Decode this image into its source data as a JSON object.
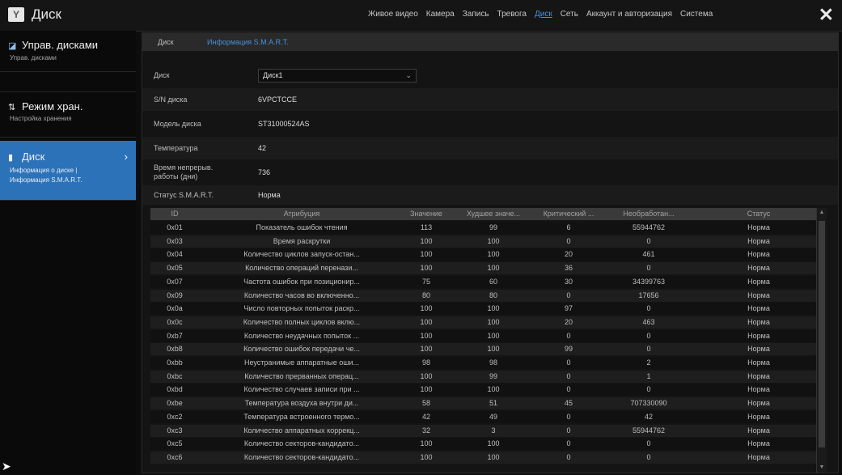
{
  "app": {
    "title": "Диск"
  },
  "nav": {
    "items": [
      "Живое видео",
      "Камера",
      "Запись",
      "Тревога",
      "Диск",
      "Сеть",
      "Аккаунт и авторизация",
      "Система"
    ],
    "active": "Диск"
  },
  "sidebar": {
    "items": [
      {
        "title": "Управ. дисками",
        "subs": [
          "Управ. дисками"
        ]
      },
      {
        "title": "Режим хран.",
        "subs": [
          "Настройка хранения"
        ]
      },
      {
        "title": "Диск",
        "subs": [
          "Информация о диске |",
          "Информация S.M.A.R.T."
        ]
      }
    ]
  },
  "breadcrumb": {
    "items": [
      "Диск",
      "Информация S.M.A.R.T."
    ]
  },
  "fields": {
    "disk_label": "Диск",
    "disk_value": "Диск1",
    "sn_label": "S/N диска",
    "sn_value": "6VPCTCCE",
    "model_label": "Модель диска",
    "model_value": "ST31000524AS",
    "temp_label": "Температура",
    "temp_value": "42",
    "uptime_label": "Время непрерыв. работы (дни)",
    "uptime_value": "736",
    "status_label": "Статус S.M.A.R.T.",
    "status_value": "Норма"
  },
  "table": {
    "headers": [
      "ID",
      "Атрибуция",
      "Значение",
      "Худшее значе...",
      "Критический ...",
      "Необработан...",
      "Статус"
    ],
    "rows": [
      [
        "0x01",
        "Показатель ошибок чтения",
        "113",
        "99",
        "6",
        "55944762",
        "Норма"
      ],
      [
        "0x03",
        "Время раскрутки",
        "100",
        "100",
        "0",
        "0",
        "Норма"
      ],
      [
        "0x04",
        "Количество циклов запуск-остан...",
        "100",
        "100",
        "20",
        "461",
        "Норма"
      ],
      [
        "0x05",
        "Количество операций перенази...",
        "100",
        "100",
        "36",
        "0",
        "Норма"
      ],
      [
        "0x07",
        "Частота ошибок при позиционир...",
        "75",
        "60",
        "30",
        "34399763",
        "Норма"
      ],
      [
        "0x09",
        "Количество часов во включенно...",
        "80",
        "80",
        "0",
        "17656",
        "Норма"
      ],
      [
        "0x0a",
        "Число повторных попыток раскр...",
        "100",
        "100",
        "97",
        "0",
        "Норма"
      ],
      [
        "0x0c",
        "Количество полных циклов вклю...",
        "100",
        "100",
        "20",
        "463",
        "Норма"
      ],
      [
        "0xb7",
        "Количество неудачных попыток ...",
        "100",
        "100",
        "0",
        "0",
        "Норма"
      ],
      [
        "0xb8",
        "Количество ошибок передачи че...",
        "100",
        "100",
        "99",
        "0",
        "Норма"
      ],
      [
        "0xbb",
        "Неустранимые аппаратные оши...",
        "98",
        "98",
        "0",
        "2",
        "Норма"
      ],
      [
        "0xbc",
        "Количество прерванных операц...",
        "100",
        "99",
        "0",
        "1",
        "Норма"
      ],
      [
        "0xbd",
        "Количество случаев записи при ...",
        "100",
        "100",
        "0",
        "0",
        "Норма"
      ],
      [
        "0xbe",
        "Температура воздуха внутри ди...",
        "58",
        "51",
        "45",
        "707330090",
        "Норма"
      ],
      [
        "0xc2",
        "Температура встроенного термо...",
        "42",
        "49",
        "0",
        "42",
        "Норма"
      ],
      [
        "0xc3",
        "Количество аппаратных коррекц...",
        "32",
        "3",
        "0",
        "55944762",
        "Норма"
      ],
      [
        "0xc5",
        "Количество секторов-кандидато...",
        "100",
        "100",
        "0",
        "0",
        "Норма"
      ],
      [
        "0xc6",
        "Количество секторов-кандидато...",
        "100",
        "100",
        "0",
        "0",
        "Норма"
      ]
    ]
  }
}
